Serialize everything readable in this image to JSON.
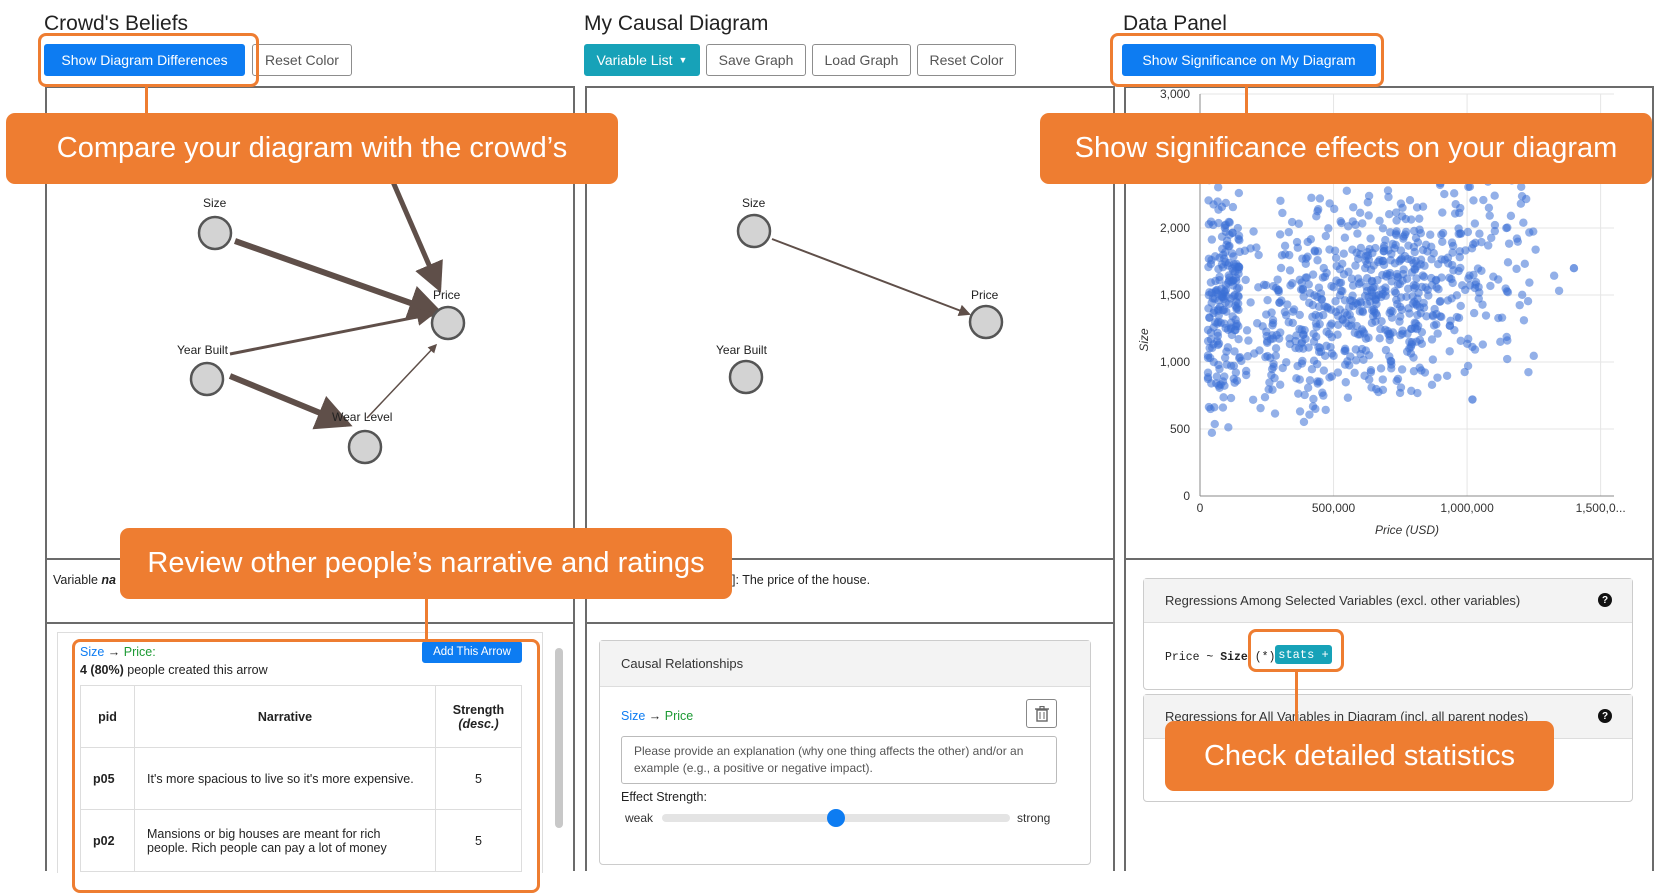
{
  "crowd": {
    "title": "Crowd's Beliefs",
    "show_diff_btn": "Show Diagram Differences",
    "reset_btn": "Reset Color",
    "nodes": {
      "size": "Size",
      "price": "Price",
      "year": "Year Built",
      "wear": "Wear Level"
    },
    "variable_desc_prefix": "Variable ",
    "variable_desc_italic": "na",
    "arrow": {
      "from": "Size",
      "arrow_sym": " → ",
      "to": "Price:",
      "count_bold": "4 (80%)",
      "count_rest": " people created this arrow",
      "add_btn": "Add This Arrow"
    },
    "table": {
      "headers": {
        "pid": "pid",
        "narrative": "Narrative",
        "strength": "Strength",
        "strength_sub": "(desc.)"
      },
      "rows": [
        {
          "pid": "p05",
          "narrative": "It's more spacious to live so it's more expensive.",
          "strength": "5"
        },
        {
          "pid": "p02",
          "narrative": "Mansions or big houses are meant for rich people. Rich people can pay a lot of money",
          "strength": "5"
        }
      ]
    }
  },
  "mine": {
    "title": "My Causal Diagram",
    "variable_list_btn": "Variable List",
    "save_btn": "Save Graph",
    "load_btn": "Load Graph",
    "reset_btn": "Reset Color",
    "nodes": {
      "size": "Size",
      "price": "Price",
      "year": "Year Built"
    },
    "variable_desc": "]: The price of the house.",
    "causal_header": "Causal Relationships",
    "rel_from": "Size",
    "rel_arrow": " → ",
    "rel_to": "Price",
    "explanation_placeholder": "Please provide an explanation (why one thing affects the other) and/or an example (e.g., a positive or negative impact).",
    "effect_label": "Effect Strength:",
    "weak": "weak",
    "strong": "strong",
    "effect_strength_fraction": 0.5
  },
  "data": {
    "title": "Data Panel",
    "sig_btn": "Show Significance on My Diagram",
    "reg1_header": "Regressions Among Selected Variables (excl. other variables)",
    "reg1_formula_a": "Price ~ ",
    "reg1_formula_b": "Size",
    "reg1_formula_c": " (*)",
    "stats_btn": "stats +",
    "reg2_header": "Regressions for All Variables in Diagram (incl. all parent nodes)",
    "help_icon": "?"
  },
  "callouts": {
    "compare": "Compare your diagram with the crowd’s",
    "significance": "Show significance effects on your diagram",
    "review": "Review other people’s narrative and ratings",
    "detail": "Check detailed statistics"
  },
  "chart_data": {
    "type": "scatter",
    "xlabel": "Price (USD)",
    "ylabel": "Size",
    "x_ticks": [
      "0",
      "500,000",
      "1,000,000",
      "1,500,0..."
    ],
    "y_ticks": [
      "0",
      "500",
      "1,000",
      "1,500",
      "2,000",
      "2,500",
      "3,000"
    ],
    "xlim": [
      0,
      1550000
    ],
    "ylim": [
      0,
      3000
    ],
    "color": "#3a6fd6",
    "n_points": 900,
    "cluster_center": {
      "x": 650000,
      "y": 1500
    },
    "range_x": [
      30000,
      1400000
    ],
    "range_y": [
      450,
      2650
    ],
    "outliers": [
      {
        "x": 1400000,
        "y": 1700
      },
      {
        "x": 1020000,
        "y": 720
      }
    ]
  },
  "colors": {
    "accent": "#ee7d31",
    "primary": "#0d7cf2",
    "info": "#17a2b8",
    "edge": "#5f4f49"
  }
}
